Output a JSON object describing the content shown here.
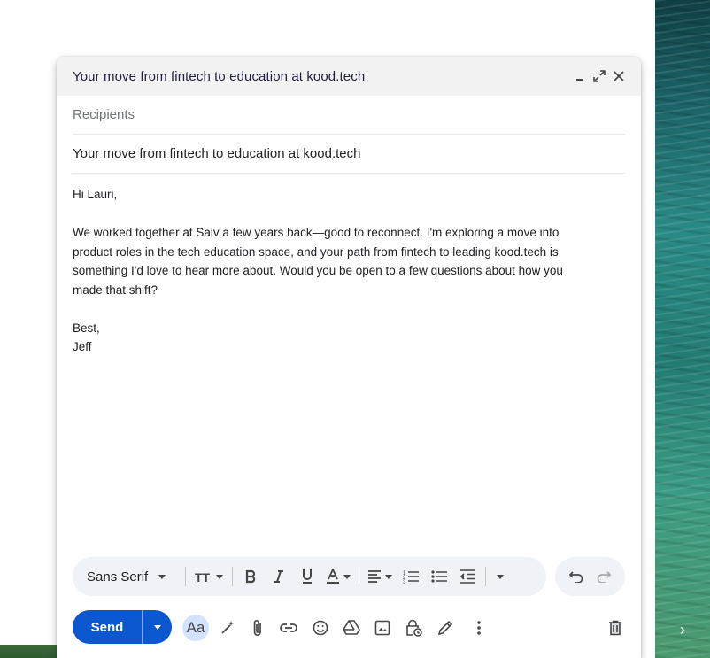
{
  "compose": {
    "title": "Your move from fintech to education at kood.tech",
    "recipients_placeholder": "Recipients",
    "subject": "Your move from fintech to education at kood.tech",
    "body": {
      "greeting": "Hi Lauri,",
      "paragraph_lines": [
        "We worked together at Salv a few years back—good to reconnect. I'm exploring a move into",
        "product roles in the tech education space, and your path from fintech to leading kood.tech is",
        "something I'd love to hear more about. Would you be open to a few questions about how you",
        "made that shift?"
      ],
      "signoff": "Best,",
      "signature": "Jeff"
    }
  },
  "toolbar": {
    "font": "Sans Serif",
    "format_toggle_label": "Aa",
    "send_label": "Send"
  },
  "colors": {
    "send": "#0b57d0",
    "toolbar_bg": "#eff2f7",
    "header_bg": "#f2f2f2"
  },
  "icons": {
    "header": [
      "minimize-icon",
      "expand-icon",
      "close-icon"
    ],
    "format": [
      "text-size-icon",
      "bold-icon",
      "italic-icon",
      "underline-icon",
      "text-color-icon",
      "align-icon",
      "numbered-list-icon",
      "bulleted-list-icon",
      "indent-less-icon",
      "more-formatting-icon"
    ],
    "actions": [
      "writing-assist-icon",
      "attach-icon",
      "link-icon",
      "emoji-icon",
      "drive-icon",
      "photo-icon",
      "confidential-icon",
      "signature-icon",
      "more-options-icon",
      "discard-icon"
    ]
  }
}
